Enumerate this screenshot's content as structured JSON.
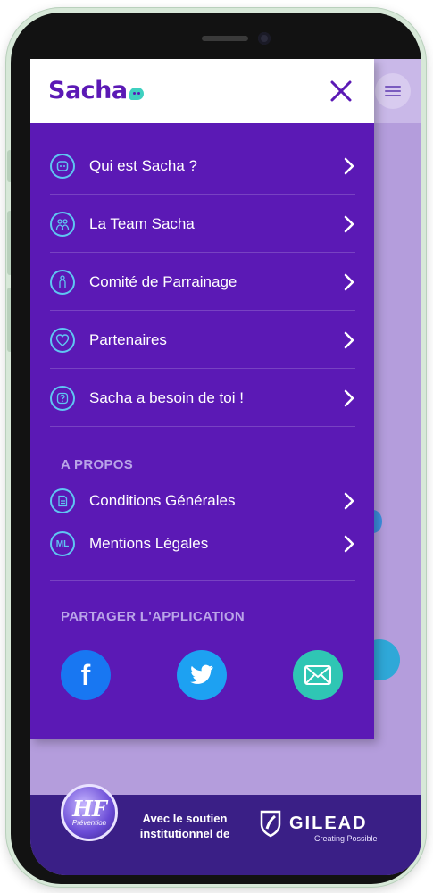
{
  "header": {
    "brand": "Sacha",
    "close_icon": "close-icon"
  },
  "menu": {
    "items": [
      {
        "label": "Qui est Sacha ?",
        "icon": "face-icon"
      },
      {
        "label": "La Team Sacha",
        "icon": "team-icon"
      },
      {
        "label": "Comité de Parrainage",
        "icon": "person-icon"
      },
      {
        "label": "Partenaires",
        "icon": "heart-icon"
      },
      {
        "label": "Sacha a besoin de toi !",
        "icon": "question-icon"
      }
    ]
  },
  "about": {
    "title": "A PROPOS",
    "items": [
      {
        "label": "Conditions Générales",
        "icon": "document-icon"
      },
      {
        "label": "Mentions Légales",
        "icon": "ml-icon",
        "icon_text": "ML"
      }
    ]
  },
  "share": {
    "title": "PARTAGER L'APPLICATION",
    "buttons": [
      {
        "name": "facebook",
        "icon": "facebook-icon",
        "glyph": "f",
        "color": "#1877f2"
      },
      {
        "name": "twitter",
        "icon": "twitter-icon",
        "color": "#1da1f2"
      },
      {
        "name": "email",
        "icon": "mail-icon",
        "color": "#2fc6b4"
      }
    ]
  },
  "footer": {
    "hf_logo": "HF",
    "hf_sub": "Prévention",
    "support_line1": "Avec le soutien",
    "support_line2": "institutionnel de",
    "sponsor": "GILEAD",
    "sponsor_tagline": "Creating Possible"
  },
  "colors": {
    "drawer": "#5b19b5",
    "accent": "#5fc6f2",
    "brand_dot": "#3fd0c0",
    "footer": "#3a1f86"
  }
}
